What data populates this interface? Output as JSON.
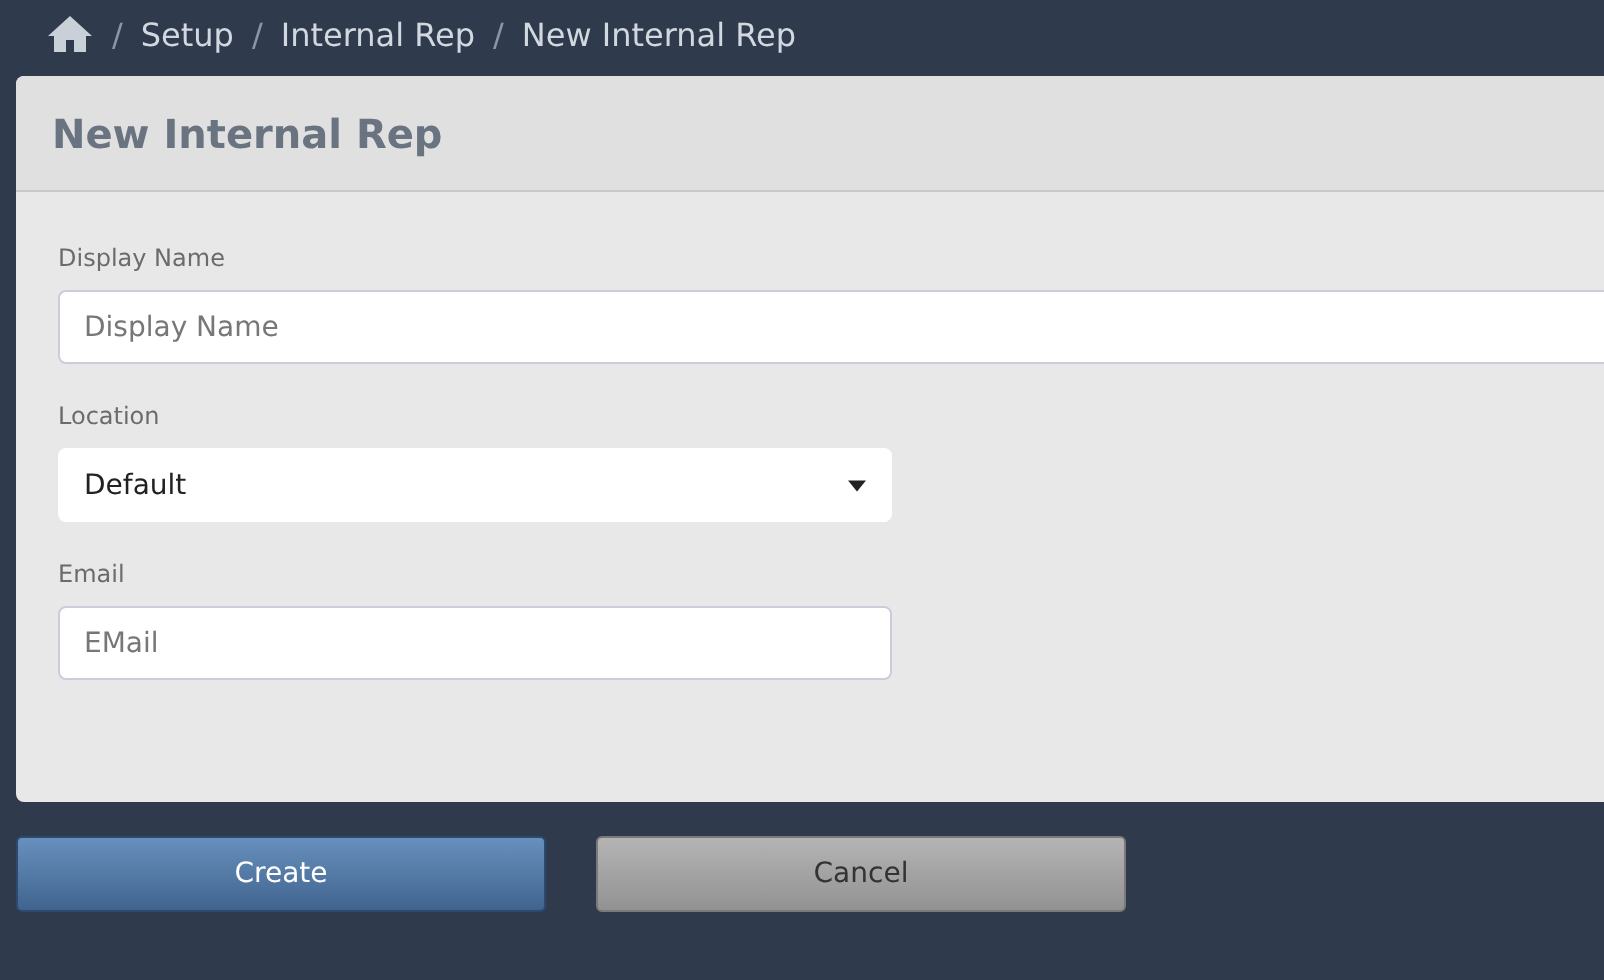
{
  "breadcrumb": {
    "separator": "/",
    "items": [
      "Setup",
      "Internal Rep",
      "New Internal Rep"
    ]
  },
  "panel": {
    "title": "New Internal Rep"
  },
  "fields": [
    {
      "kind": "text",
      "label": "Display Name",
      "placeholder": "Display Name",
      "wide": true
    },
    {
      "kind": "select",
      "label": "Location",
      "value": "Default",
      "wide": false
    },
    {
      "kind": "text",
      "label": "Email",
      "placeholder": "EMail",
      "wide": false
    }
  ],
  "buttons": [
    {
      "kind": "primary",
      "label": "Create"
    },
    {
      "kind": "secondary",
      "label": "Cancel"
    }
  ]
}
